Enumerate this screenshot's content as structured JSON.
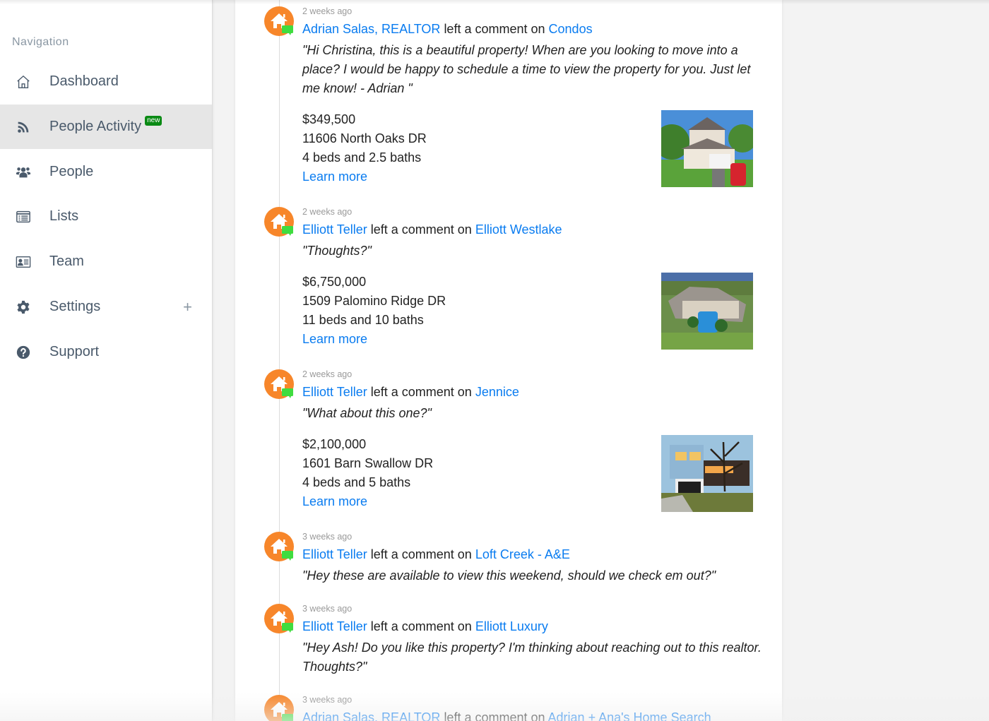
{
  "sidebar": {
    "heading": "Navigation",
    "items": [
      {
        "label": "Dashboard",
        "icon": "home-outline-icon"
      },
      {
        "label": "People Activity",
        "icon": "rss-icon",
        "badge": "new",
        "active": true
      },
      {
        "label": "People",
        "icon": "users-icon"
      },
      {
        "label": "Lists",
        "icon": "list-icon"
      },
      {
        "label": "Team",
        "icon": "id-card-icon"
      },
      {
        "label": "Settings",
        "icon": "gear-icon",
        "expand": "+"
      },
      {
        "label": "Support",
        "icon": "question-circle-icon"
      }
    ]
  },
  "colors": {
    "link": "#0a7cf0",
    "avatar": "#f7862a",
    "comment_badge": "#3fdc3f",
    "new_badge": "#0a8a14",
    "active_nav": "#e6e6e6"
  },
  "feed": [
    {
      "time": "2 weeks ago",
      "actor": "Adrian Salas, REALTOR",
      "action": "left a comment on",
      "target": "Condos",
      "quote": "\"Hi Christina, this is a beautiful property! When are you looking to move into a place? I would be happy to schedule a time to view the property for you. Just let me know! - Adrian \"",
      "listing": {
        "price": "$349,500",
        "address": "11606 North Oaks DR",
        "details": "4 beds and 2.5 baths",
        "link": "Learn more",
        "image": "suburban-house-photo"
      }
    },
    {
      "time": "2 weeks ago",
      "actor": "Elliott Teller",
      "action": "left a comment on",
      "target": "Elliott Westlake",
      "quote": "\"Thoughts?\"",
      "listing": {
        "price": "$6,750,000",
        "address": "1509 Palomino Ridge DR",
        "details": "11 beds and 10 baths",
        "link": "Learn more",
        "image": "estate-with-pool-photo"
      }
    },
    {
      "time": "2 weeks ago",
      "actor": "Elliott Teller",
      "action": "left a comment on",
      "target": "Jennice",
      "quote": "\"What about this one?\"",
      "listing": {
        "price": "$2,100,000",
        "address": "1601 Barn Swallow DR",
        "details": "4 beds and 5 baths",
        "link": "Learn more",
        "image": "modern-house-dusk-photo"
      }
    },
    {
      "time": "3 weeks ago",
      "actor": "Elliott Teller",
      "action": "left a comment on",
      "target": "Loft Creek - A&E",
      "quote": "\"Hey these are available to view this weekend, should we check em out?\""
    },
    {
      "time": "3 weeks ago",
      "actor": "Elliott Teller",
      "action": "left a comment on",
      "target": "Elliott Luxury",
      "quote": "\"Hey Ash! Do you like this property? I'm thinking about reaching out to this realtor. Thoughts?\""
    },
    {
      "time": "3 weeks ago",
      "actor": "Adrian Salas, REALTOR",
      "action": "left a comment on",
      "target": "Adrian + Ana's Home Search"
    }
  ]
}
